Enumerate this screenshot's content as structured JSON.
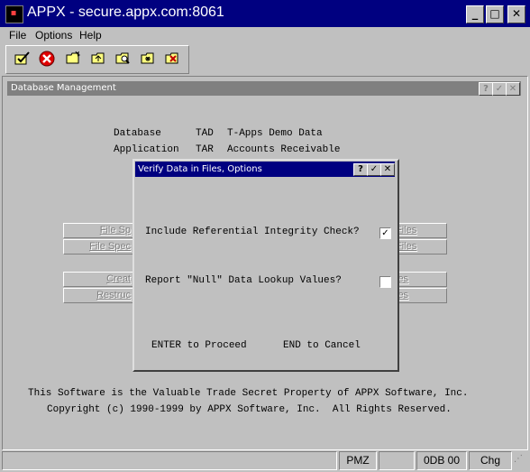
{
  "window": {
    "title": "APPX - secure.appx.com:8061",
    "controls": {
      "minimize": "_",
      "maximize": "□",
      "close": "✕"
    }
  },
  "menu": [
    "File",
    "Options",
    "Help"
  ],
  "toolbar": {
    "icons": [
      "check-edit-icon",
      "cancel-icon",
      "folder-new-icon",
      "folder-up-icon",
      "folder-search-icon",
      "folder-star-icon",
      "folder-delete-icon"
    ]
  },
  "db_management": {
    "title": "Database Management",
    "help": "?",
    "ok": "✓",
    "close": "✕",
    "database_label": "Database",
    "database_code": "TAD",
    "database_name": "T-Apps Demo Data",
    "application_label": "Application",
    "application_code": "TAR",
    "application_name": "Accounts Receivable",
    "left_buttons": [
      "File Sp",
      "File Spec",
      "Creat",
      "Restruc"
    ],
    "right_buttons": [
      "Files",
      "Files",
      "les",
      "les"
    ],
    "copyright_line1": "This Software is the Valuable Trade Secret Property of APPX Software, Inc.",
    "copyright_line2": "Copyright (c) 1990-1999 by APPX Software, Inc.  All Rights Reserved."
  },
  "dialog": {
    "title": "Verify Data in Files, Options",
    "help": "?",
    "ok": "✓",
    "close": "✕",
    "option1_label": "Include Referential Integrity Check?",
    "option1_checked": true,
    "option1_mark": "✓",
    "option2_label": "Report \"Null\" Data Lookup Values?",
    "option2_checked": false,
    "enter_hint": "ENTER to Proceed",
    "end_hint": "END to Cancel"
  },
  "statusbar": [
    "",
    "PMZ",
    "",
    "0DB 00",
    "Chg"
  ]
}
